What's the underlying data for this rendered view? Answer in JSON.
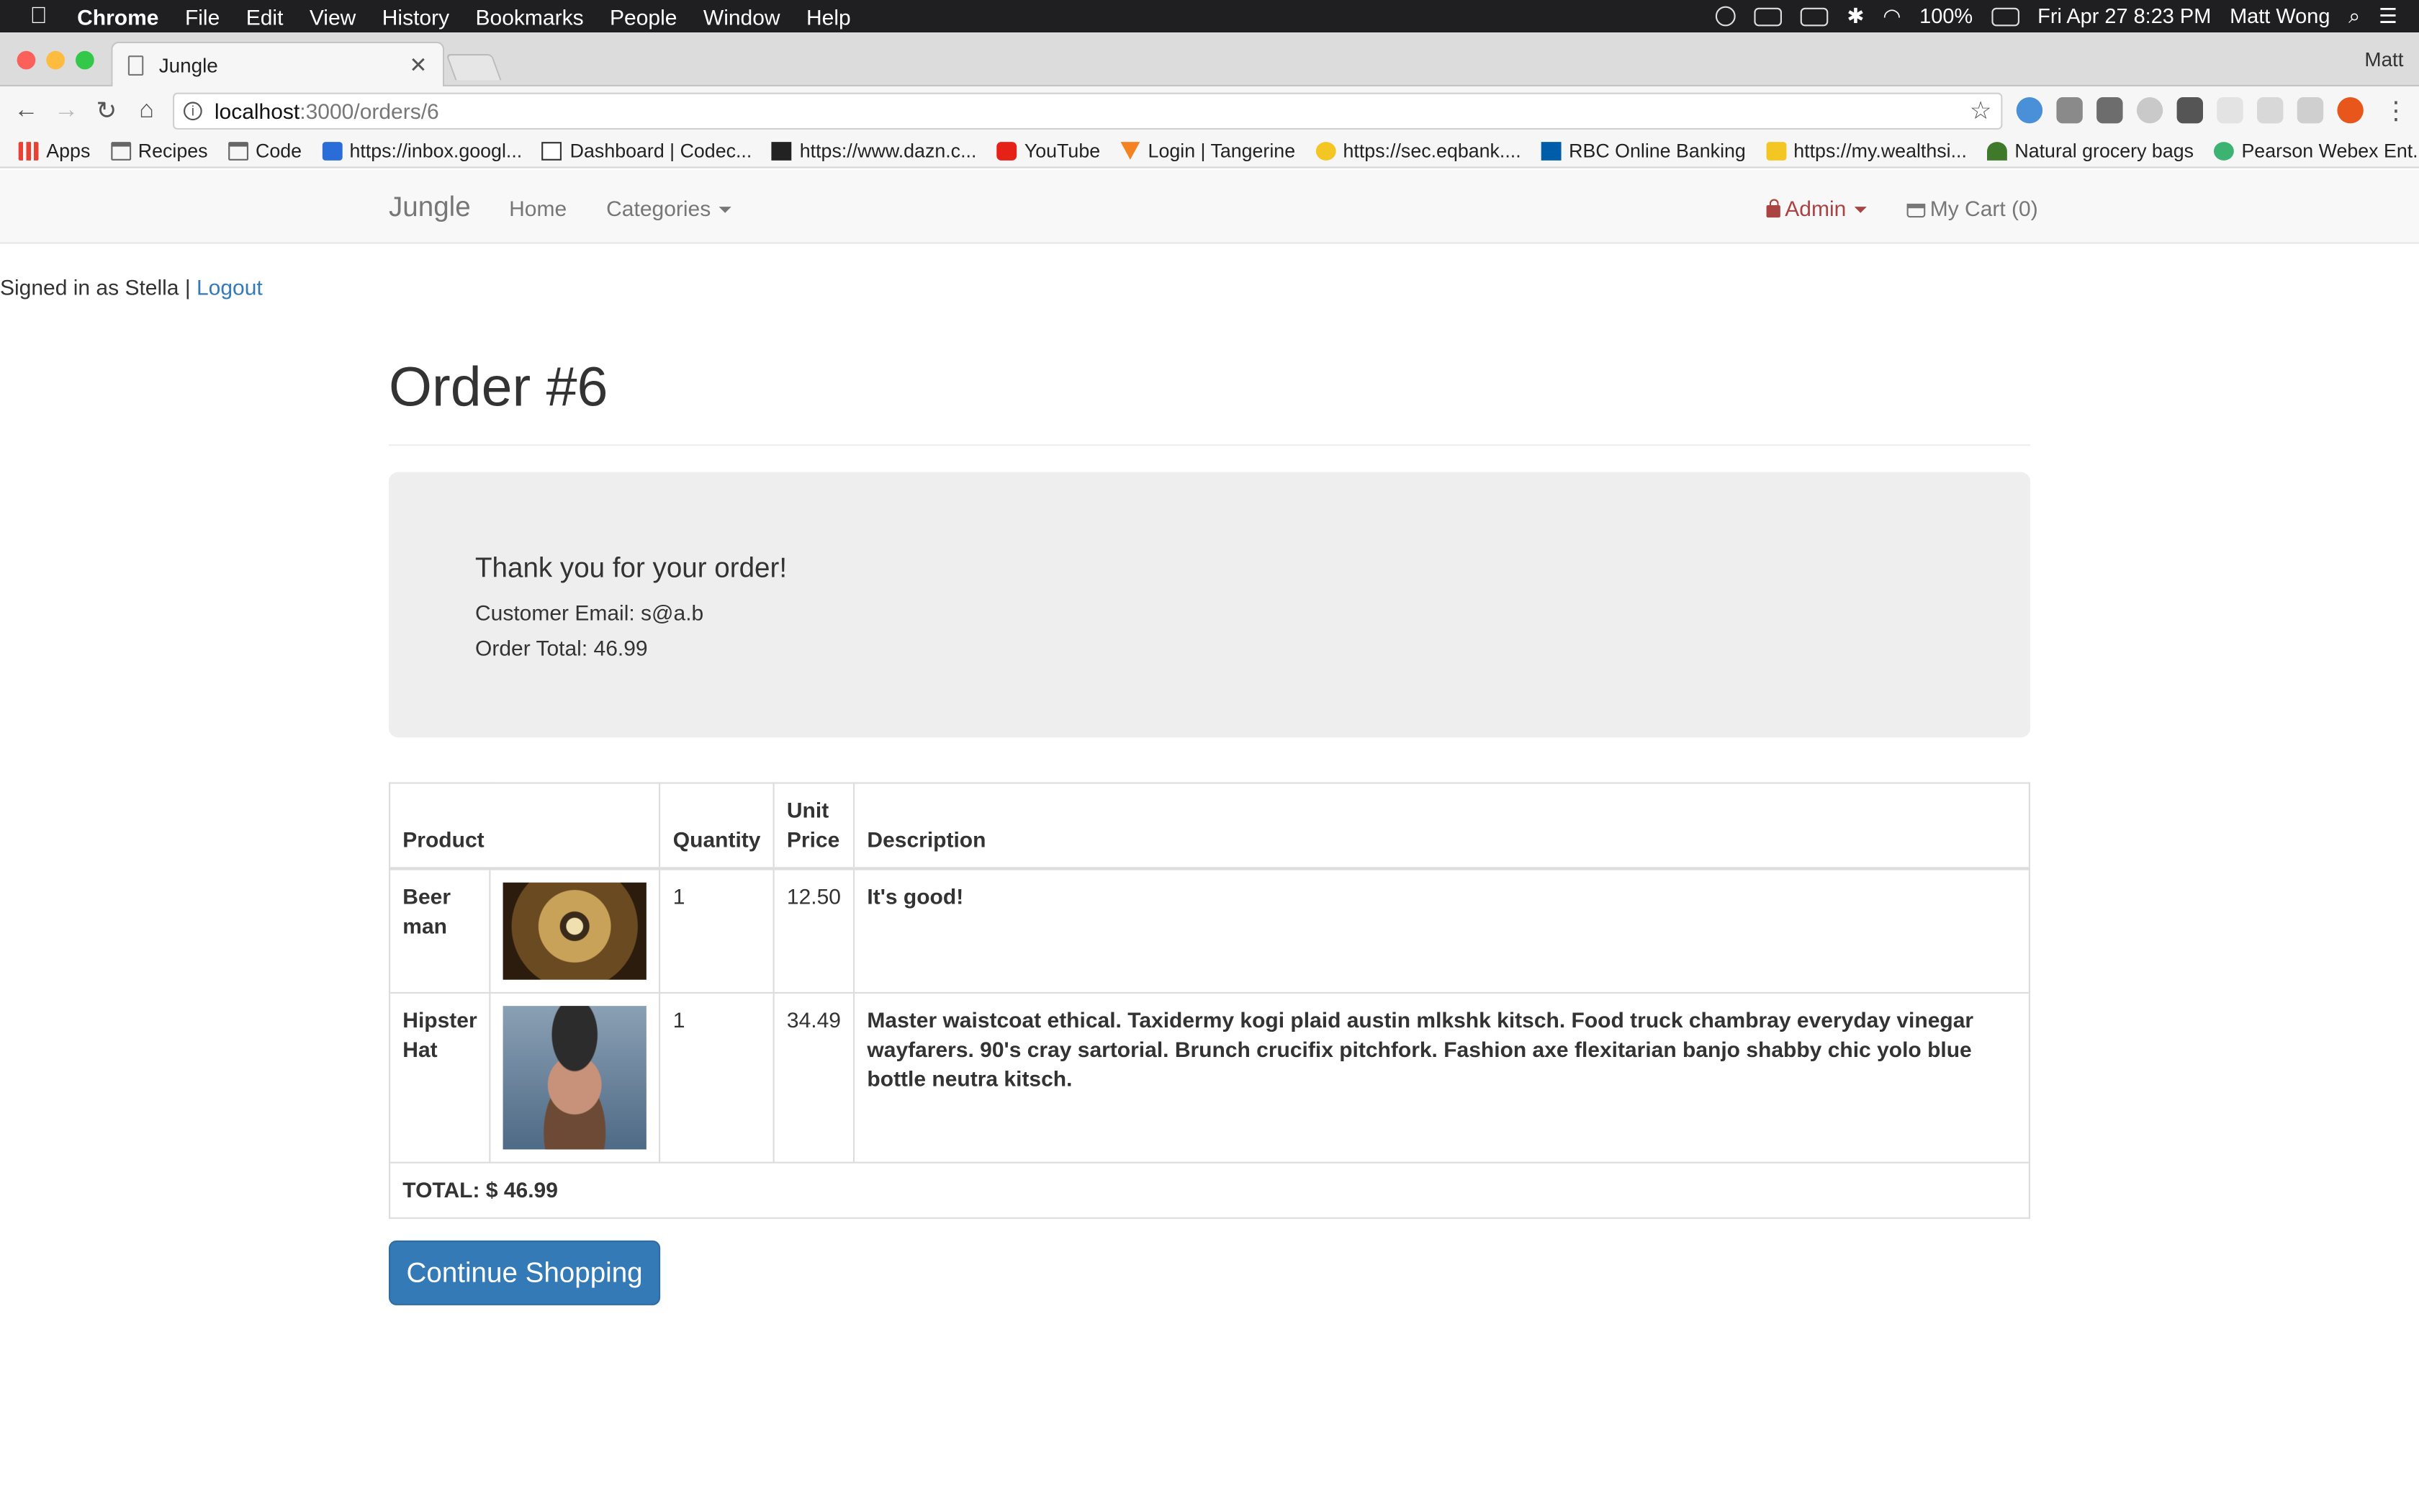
{
  "menubar": {
    "app_name": "Chrome",
    "menus": [
      "File",
      "Edit",
      "View",
      "History",
      "Bookmarks",
      "People",
      "Window",
      "Help"
    ],
    "battery": "100%",
    "datetime": "Fri Apr 27  8:23 PM",
    "user": "Matt Wong"
  },
  "browser": {
    "tab_title": "Jungle",
    "profile": "Matt",
    "url_host": "localhost",
    "url_path": ":3000/orders/6",
    "bookmarks": [
      {
        "label": "Apps",
        "icon": "apps-icon"
      },
      {
        "label": "Recipes",
        "icon": "folder-icon"
      },
      {
        "label": "Code",
        "icon": "folder-icon"
      },
      {
        "label": "https://inbox.googl...",
        "icon": "inbox-icon"
      },
      {
        "label": "Dashboard | Codec...",
        "icon": "codecademy-icon"
      },
      {
        "label": "https://www.dazn.c...",
        "icon": "dazn-icon"
      },
      {
        "label": "YouTube",
        "icon": "youtube-icon"
      },
      {
        "label": "Login | Tangerine",
        "icon": "tangerine-icon"
      },
      {
        "label": "https://sec.eqbank....",
        "icon": "eqbank-icon"
      },
      {
        "label": "RBC Online Banking",
        "icon": "rbc-icon"
      },
      {
        "label": "https://my.wealthsi...",
        "icon": "wealthsimple-icon"
      },
      {
        "label": "Natural grocery bags",
        "icon": "grocery-icon"
      },
      {
        "label": "Pearson Webex Ent...",
        "icon": "webex-icon"
      }
    ],
    "bookmarks_more": "»"
  },
  "navbar": {
    "brand": "Jungle",
    "home": "Home",
    "categories": "Categories",
    "admin": "Admin",
    "cart": "My Cart (0)"
  },
  "session": {
    "signed_in_text": "Signed in as Stella | ",
    "logout": "Logout"
  },
  "order": {
    "title": "Order #6",
    "thank_you": "Thank you for your order!",
    "email_line": "Customer Email: s@a.b",
    "total_line": "Order Total: 46.99",
    "headers": {
      "product": "Product",
      "quantity": "Quantity",
      "unit_price": "Unit Price",
      "description": "Description"
    },
    "items": [
      {
        "name": "Beer man",
        "quantity": "1",
        "unit_price": "12.50",
        "description": "It's good!"
      },
      {
        "name": "Hipster Hat",
        "quantity": "1",
        "unit_price": "34.49",
        "description": "Master waistcoat ethical. Taxidermy kogi plaid austin mlkshk kitsch. Food truck chambray everyday vinegar wayfarers. 90's cray sartorial. Brunch crucifix pitchfork. Fashion axe flexitarian banjo shabby chic yolo blue bottle neutra kitsch."
      }
    ],
    "total": "TOTAL: $ 46.99",
    "continue_button": "Continue Shopping"
  },
  "colors": {
    "link": "#337ab7",
    "admin": "#a94442",
    "button": "#337ab7"
  }
}
